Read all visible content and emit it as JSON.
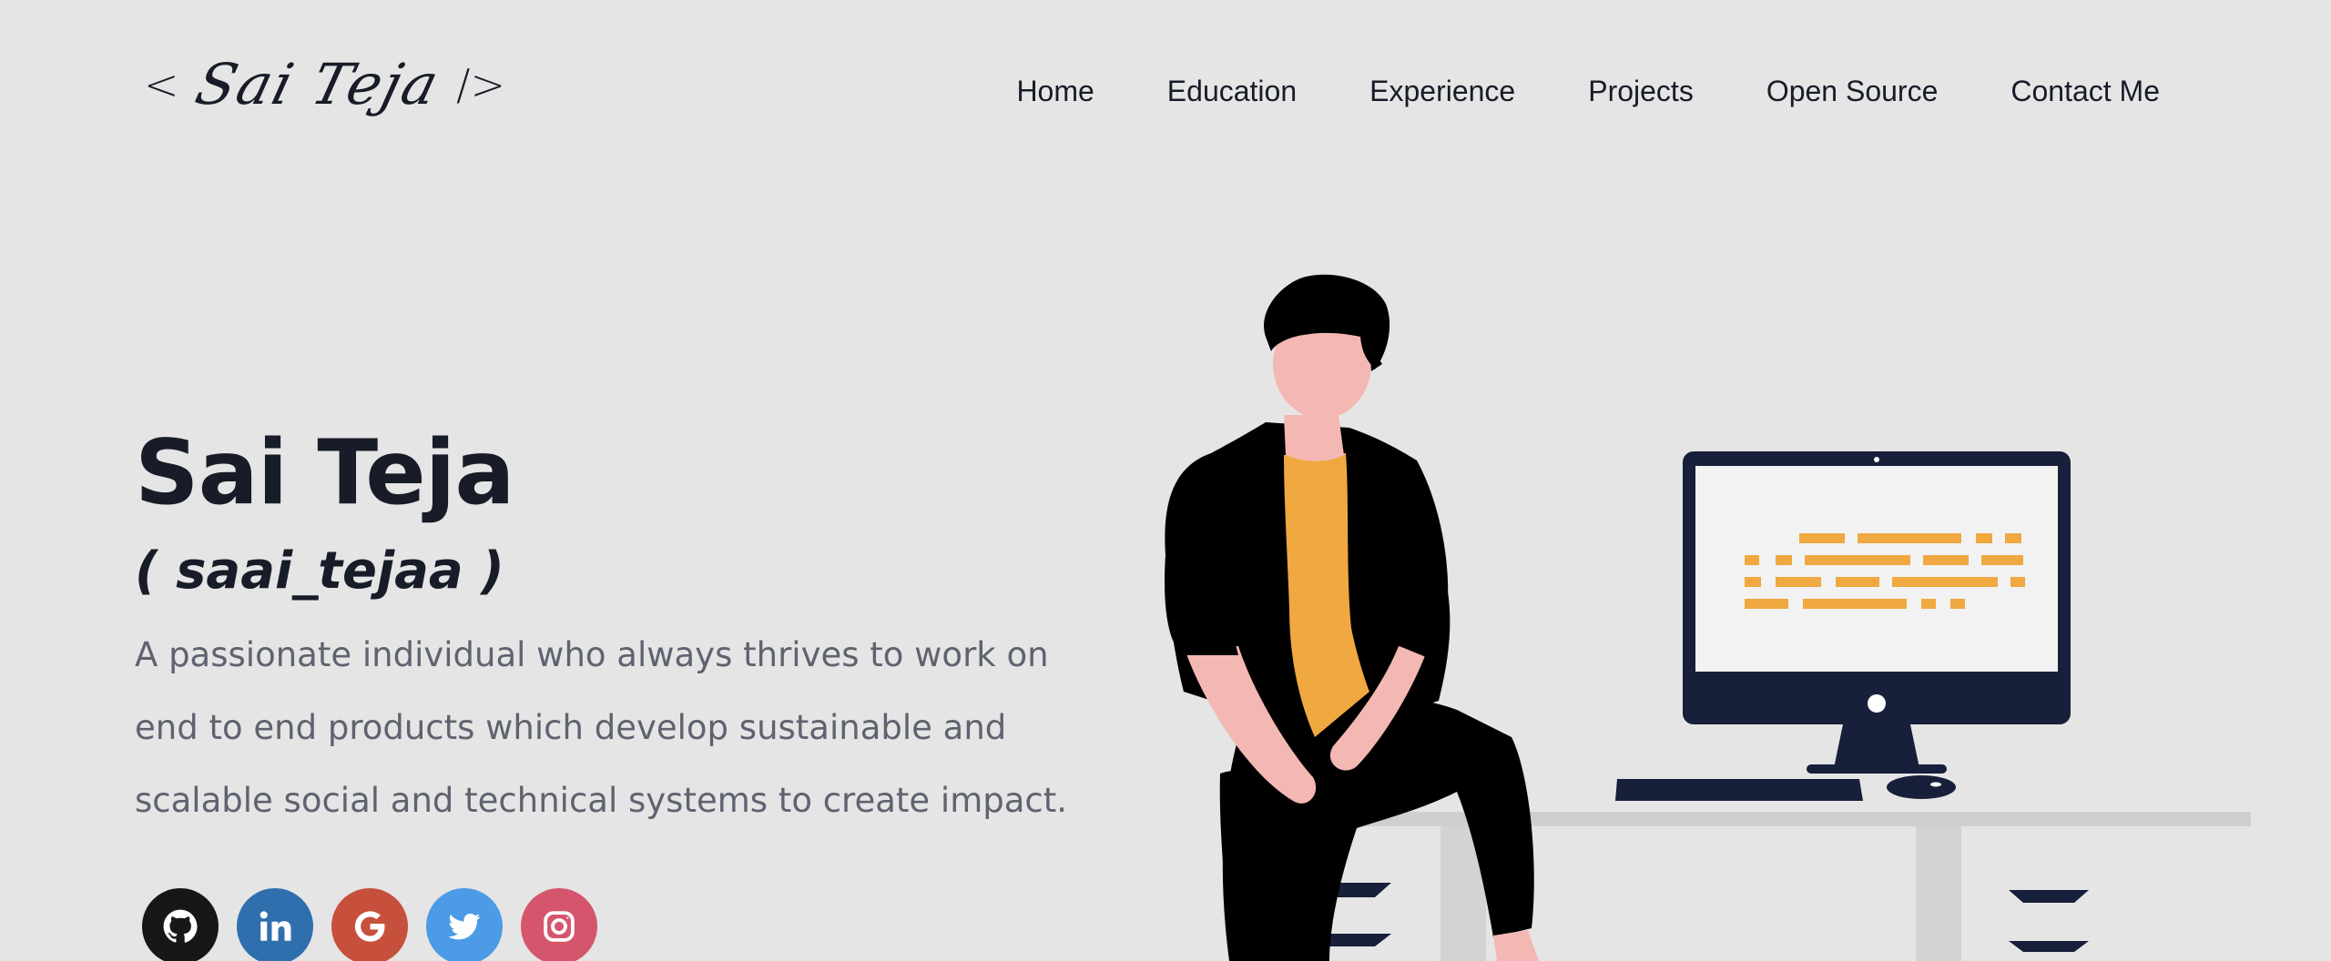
{
  "header": {
    "logo": {
      "open_bracket": "<",
      "name": "Sai Teja",
      "close_bracket": "/>"
    },
    "nav": [
      "Home",
      "Education",
      "Experience",
      "Projects",
      "Open Source",
      "Contact Me"
    ]
  },
  "hero": {
    "title": "Sai Teja",
    "handle": "( saai_tejaa )",
    "description": "A passionate individual who always thrives to work on end to end products which develop sustainable and scalable social and technical systems to create impact."
  },
  "social": [
    {
      "name": "github",
      "icon": "github-icon",
      "color": "#181717"
    },
    {
      "name": "linkedin",
      "icon": "linkedin-icon",
      "color": "#2f6fae"
    },
    {
      "name": "google",
      "icon": "google-icon",
      "color": "#c6503c"
    },
    {
      "name": "twitter",
      "icon": "twitter-icon",
      "color": "#4b9be6"
    },
    {
      "name": "instagram",
      "icon": "instagram-icon",
      "color": "#d5566c"
    }
  ],
  "colors": {
    "background": "#e5e5e5",
    "text_primary": "#171c28",
    "text_secondary": "#5f6370",
    "accent": "#f0a840"
  }
}
